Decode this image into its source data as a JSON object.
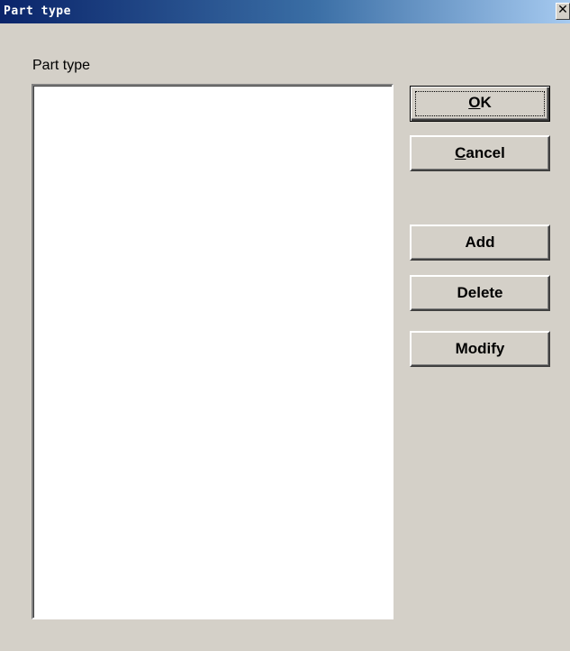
{
  "window": {
    "title": "Part type",
    "close_glyph": "✕"
  },
  "list": {
    "label": "Part type",
    "items": []
  },
  "buttons": {
    "ok": {
      "mnemonic": "O",
      "rest": "K"
    },
    "cancel": {
      "mnemonic": "C",
      "rest": "ancel"
    },
    "add": "Add",
    "delete": "Delete",
    "modify": "Modify"
  },
  "colors": {
    "face": "#d4d0c8",
    "title_start": "#0a246a",
    "title_end": "#a6caf0",
    "list_bg": "#ffffff"
  }
}
